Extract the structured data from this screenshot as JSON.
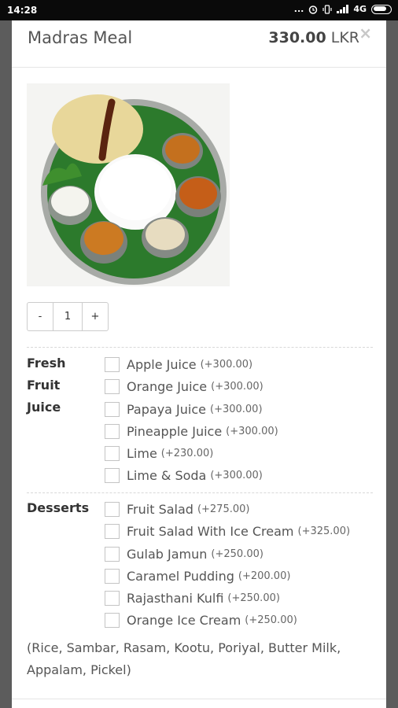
{
  "status_bar": {
    "time": "14:28",
    "dots": "...",
    "network": "4G"
  },
  "meal": {
    "title": "Madras Meal",
    "price": "330.00",
    "currency": "LKR",
    "close_symbol": "×",
    "image_alt": "Madras meal plate"
  },
  "quantity": {
    "minus": "-",
    "value": "1",
    "plus": "+"
  },
  "option_groups": [
    {
      "label_lines": [
        "Fresh",
        "Fruit",
        "Juice"
      ],
      "options": [
        {
          "name": "Apple Juice",
          "price": "(+300.00)"
        },
        {
          "name": "Orange Juice",
          "price": "(+300.00)"
        },
        {
          "name": "Papaya Juice",
          "price": "(+300.00)"
        },
        {
          "name": "Pineapple Juice",
          "price": "(+300.00)"
        },
        {
          "name": "Lime",
          "price": "(+230.00)"
        },
        {
          "name": "Lime & Soda",
          "price": "(+300.00)"
        }
      ]
    },
    {
      "label_lines": [
        "Desserts"
      ],
      "options": [
        {
          "name": "Fruit Salad",
          "price": "(+275.00)"
        },
        {
          "name": "Fruit Salad With Ice Cream",
          "price": "(+325.00)"
        },
        {
          "name": "Gulab Jamun",
          "price": "(+250.00)"
        },
        {
          "name": "Caramel Pudding",
          "price": "(+200.00)"
        },
        {
          "name": "Rajasthani Kulfi",
          "price": "(+250.00)"
        },
        {
          "name": "Orange Ice Cream",
          "price": "(+250.00)"
        }
      ]
    }
  ],
  "description": "(Rice, Sambar, Rasam, Kootu, Poriyal, Butter Milk, Appalam, Pickel)"
}
